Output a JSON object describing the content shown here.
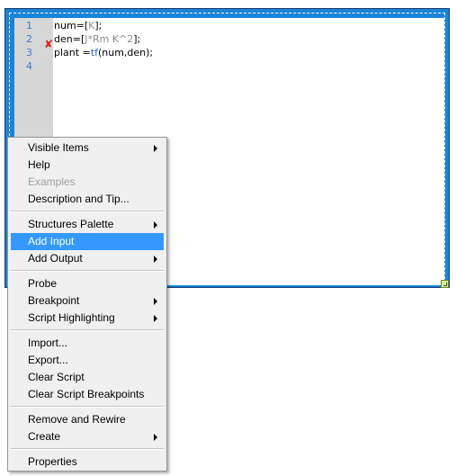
{
  "editor": {
    "line_numbers": [
      "1",
      "2",
      "3",
      "4"
    ],
    "lines": [
      {
        "parts": [
          {
            "t": "num=[",
            "c": "plain"
          },
          {
            "t": "K",
            "c": "mut"
          },
          {
            "t": "];",
            "c": "plain"
          }
        ]
      },
      {
        "parts": [
          {
            "t": "den=[",
            "c": "plain"
          },
          {
            "t": "J*Rm K^2",
            "c": "mut"
          },
          {
            "t": "];",
            "c": "plain"
          }
        ]
      },
      {
        "parts": [
          {
            "t": "plant =",
            "c": "plain"
          },
          {
            "t": "tf",
            "c": "fn"
          },
          {
            "t": "(num,den);",
            "c": "plain"
          }
        ]
      },
      {
        "parts": []
      }
    ],
    "error_line": "2",
    "error_icon": "red-x-icon"
  },
  "menu": {
    "items": [
      {
        "label": "Visible Items",
        "submenu": true,
        "disabled": false
      },
      {
        "label": "Help",
        "submenu": false,
        "disabled": false
      },
      {
        "label": "Examples",
        "submenu": false,
        "disabled": true
      },
      {
        "label": "Description and Tip...",
        "submenu": false,
        "disabled": false
      },
      {
        "sep": true
      },
      {
        "label": "Structures Palette",
        "submenu": true,
        "disabled": false
      },
      {
        "label": "Add Input",
        "submenu": false,
        "disabled": false,
        "active": true
      },
      {
        "label": "Add Output",
        "submenu": true,
        "disabled": false
      },
      {
        "sep": true
      },
      {
        "label": "Probe",
        "submenu": false,
        "disabled": false
      },
      {
        "label": "Breakpoint",
        "submenu": true,
        "disabled": false
      },
      {
        "label": "Script Highlighting",
        "submenu": true,
        "disabled": false
      },
      {
        "sep": true
      },
      {
        "label": "Import...",
        "submenu": false,
        "disabled": false
      },
      {
        "label": "Export...",
        "submenu": false,
        "disabled": false
      },
      {
        "label": "Clear Script",
        "submenu": false,
        "disabled": false
      },
      {
        "label": "Clear Script Breakpoints",
        "submenu": false,
        "disabled": false
      },
      {
        "sep": true
      },
      {
        "label": "Remove and Rewire",
        "submenu": false,
        "disabled": false
      },
      {
        "label": "Create",
        "submenu": true,
        "disabled": false
      },
      {
        "sep": true
      },
      {
        "label": "Properties",
        "submenu": false,
        "disabled": false
      }
    ]
  },
  "colors": {
    "node_frame": "#1a84d8",
    "highlight": "#3399ff",
    "error": "#d81e1e"
  }
}
